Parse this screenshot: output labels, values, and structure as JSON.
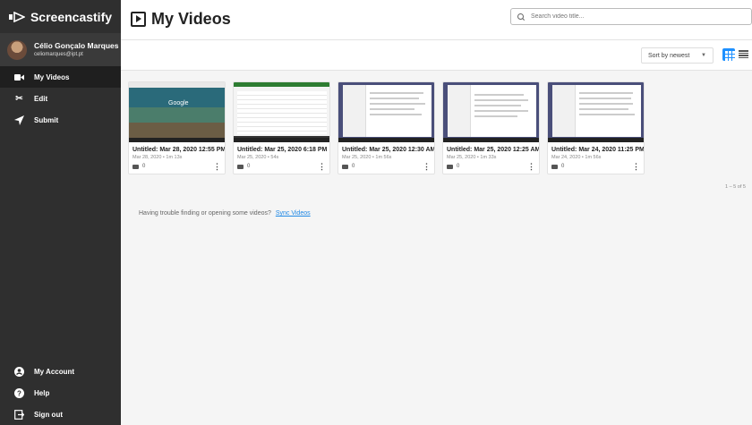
{
  "app": {
    "brand": "Screencastify"
  },
  "profile": {
    "name": "Célio Gonçalo Marques",
    "email": "celiomarques@ipt.pt"
  },
  "nav": {
    "my_videos": "My Videos",
    "edit": "Edit",
    "submit": "Submit",
    "my_account": "My Account",
    "help": "Help",
    "sign_out": "Sign out"
  },
  "header": {
    "title": "My Videos",
    "search_placeholder": "Search video title..."
  },
  "toolbar": {
    "sort_label": "Sort by newest"
  },
  "videos": [
    {
      "title": "Untitled: Mar 28, 2020 12:55 PM",
      "meta": "Mar 28, 2020 • 1m 13s",
      "views": "0"
    },
    {
      "title": "Untitled: Mar 25, 2020 6:18 PM",
      "meta": "Mar 25, 2020 • 54s",
      "views": "0"
    },
    {
      "title": "Untitled: Mar 25, 2020 12:30 AM",
      "meta": "Mar 25, 2020 • 1m 56s",
      "views": "0"
    },
    {
      "title": "Untitled: Mar 25, 2020 12:25 AM",
      "meta": "Mar 25, 2020 • 1m 33s",
      "views": "0"
    },
    {
      "title": "Untitled: Mar 24, 2020 11:25 PM",
      "meta": "Mar 24, 2020 • 1m 56s",
      "views": "0"
    }
  ],
  "thumb_text": {
    "google": "Google"
  },
  "pager": "1 – 5 of 5",
  "help": {
    "text": "Having trouble finding or opening some videos?",
    "link": "Sync Videos"
  },
  "colors": {
    "sidebar": "#2f2f2f",
    "accent": "#1e90ff",
    "link": "#1e88e5"
  }
}
